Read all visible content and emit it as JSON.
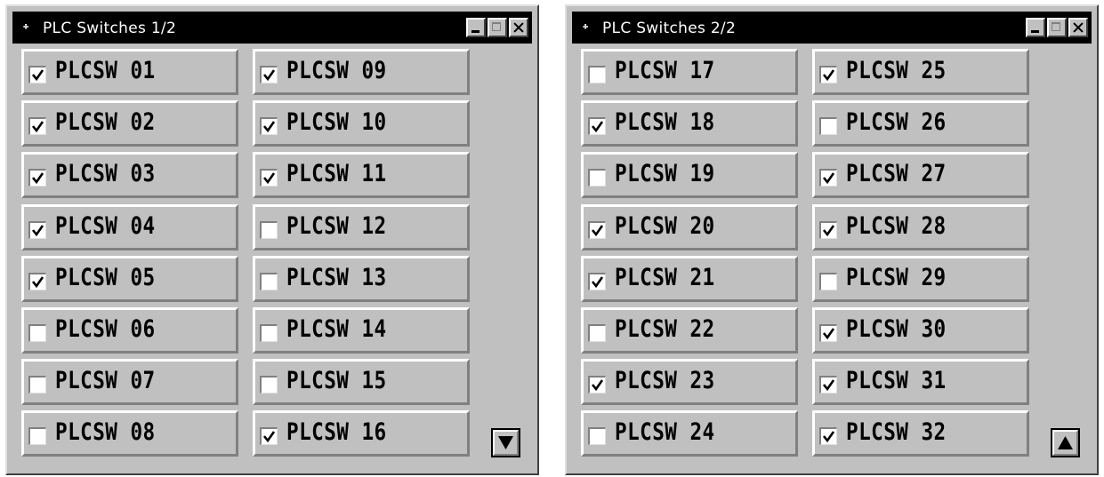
{
  "windows": [
    {
      "title": "PLC Switches 1/2",
      "title_icon": "lamp-icon",
      "nav_button": "page-down-triangle-icon",
      "switches": [
        {
          "label": "PLCSW 01",
          "checked": true
        },
        {
          "label": "PLCSW 02",
          "checked": true
        },
        {
          "label": "PLCSW 03",
          "checked": true
        },
        {
          "label": "PLCSW 04",
          "checked": true
        },
        {
          "label": "PLCSW 05",
          "checked": true
        },
        {
          "label": "PLCSW 06",
          "checked": false
        },
        {
          "label": "PLCSW 07",
          "checked": false
        },
        {
          "label": "PLCSW 08",
          "checked": false
        },
        {
          "label": "PLCSW 09",
          "checked": true
        },
        {
          "label": "PLCSW 10",
          "checked": true
        },
        {
          "label": "PLCSW 11",
          "checked": true
        },
        {
          "label": "PLCSW 12",
          "checked": false
        },
        {
          "label": "PLCSW 13",
          "checked": false
        },
        {
          "label": "PLCSW 14",
          "checked": false
        },
        {
          "label": "PLCSW 15",
          "checked": false
        },
        {
          "label": "PLCSW 16",
          "checked": true
        }
      ]
    },
    {
      "title": "PLC Switches 2/2",
      "title_icon": "lamp-icon",
      "nav_button": "page-up-triangle-icon",
      "switches": [
        {
          "label": "PLCSW 17",
          "checked": false
        },
        {
          "label": "PLCSW 18",
          "checked": true
        },
        {
          "label": "PLCSW 19",
          "checked": false
        },
        {
          "label": "PLCSW 20",
          "checked": true
        },
        {
          "label": "PLCSW 21",
          "checked": true
        },
        {
          "label": "PLCSW 22",
          "checked": false
        },
        {
          "label": "PLCSW 23",
          "checked": true
        },
        {
          "label": "PLCSW 24",
          "checked": false
        },
        {
          "label": "PLCSW 25",
          "checked": true
        },
        {
          "label": "PLCSW 26",
          "checked": false
        },
        {
          "label": "PLCSW 27",
          "checked": true
        },
        {
          "label": "PLCSW 28",
          "checked": true
        },
        {
          "label": "PLCSW 29",
          "checked": false
        },
        {
          "label": "PLCSW 30",
          "checked": true
        },
        {
          "label": "PLCSW 31",
          "checked": true
        },
        {
          "label": "PLCSW 32",
          "checked": true
        }
      ]
    }
  ],
  "colors": {
    "face": "#c0c0c0",
    "titlebar": "#000000",
    "highlight": "#ffffff",
    "shadow": "#808080"
  }
}
